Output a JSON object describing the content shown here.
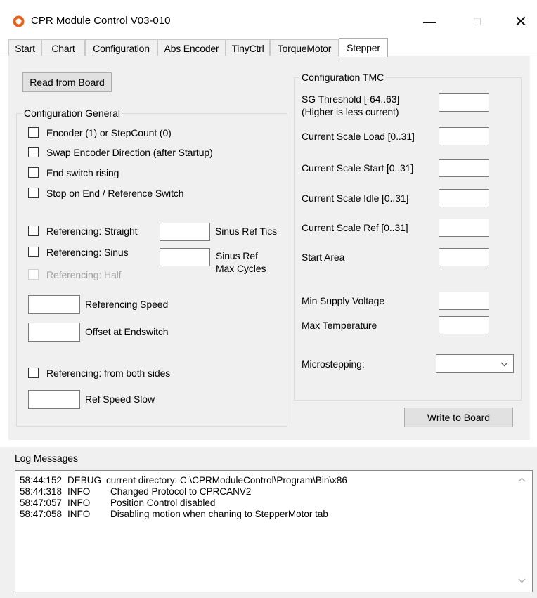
{
  "window": {
    "title": "CPR Module Control V03-010",
    "min_glyph": "—",
    "max_glyph": "☐",
    "close_glyph": "✕",
    "icon": "cpr-logo-icon",
    "icon_color": "#e8641e"
  },
  "tabs": [
    {
      "label": "Start"
    },
    {
      "label": "Chart"
    },
    {
      "label": "Configuration"
    },
    {
      "label": "Abs Encoder"
    },
    {
      "label": "TinyCtrl"
    },
    {
      "label": "TorqueMotor"
    },
    {
      "label": "Stepper",
      "active": true
    }
  ],
  "buttons": {
    "read": "Read from Board",
    "write": "Write to Board"
  },
  "config_general": {
    "title": "Configuration General",
    "checkboxes": [
      {
        "label": "Encoder (1) or StepCount (0)",
        "checked": false
      },
      {
        "label": "Swap Encoder Direction (after Startup)",
        "checked": false
      },
      {
        "label": "End switch rising",
        "checked": false
      },
      {
        "label": "Stop on End / Reference Switch",
        "checked": false
      },
      {
        "label": "Referencing: Straight",
        "checked": false
      },
      {
        "label": "Referencing: Sinus",
        "checked": false
      },
      {
        "label": "Referencing: Half",
        "checked": false,
        "disabled": true
      },
      {
        "label": "Referencing: from both sides",
        "checked": false
      }
    ],
    "sinus_ref_tics": {
      "label": "Sinus Ref Tics",
      "value": ""
    },
    "sinus_ref_max_cycles": {
      "label_line1": "Sinus Ref",
      "label_line2": "Max Cycles",
      "value": ""
    },
    "referencing_speed": {
      "label": "Referencing Speed",
      "value": ""
    },
    "offset_endswitch": {
      "label": "Offset at Endswitch",
      "value": ""
    },
    "ref_speed_slow": {
      "label": "Ref Speed Slow",
      "value": ""
    }
  },
  "config_tmc": {
    "title": "Configuration TMC",
    "sg_threshold": {
      "label_line1": "SG Threshold [-64..63]",
      "label_line2": "(Higher is less current)",
      "value": ""
    },
    "fields": [
      {
        "label": "Current Scale Load [0..31]",
        "value": ""
      },
      {
        "label": "Current Scale Start [0..31]",
        "value": ""
      },
      {
        "label": "Current Scale Idle [0..31]",
        "value": ""
      },
      {
        "label": "Current Scale Ref [0..31]",
        "value": ""
      },
      {
        "label": "Start Area",
        "value": ""
      },
      {
        "label": "Min Supply Voltage",
        "value": ""
      },
      {
        "label": "Max Temperature",
        "value": ""
      }
    ],
    "microstepping": {
      "label": "Microstepping:",
      "value": ""
    }
  },
  "log": {
    "title": "Log Messages",
    "entries": [
      {
        "time": "58:44:152",
        "level": "DEBUG",
        "message": "current directory: C:\\CPRModuleControl\\Program\\Bin\\x86"
      },
      {
        "time": "58:44:318",
        "level": "INFO",
        "message": "Changed Protocol to CPRCANV2"
      },
      {
        "time": "58:47:057",
        "level": "INFO",
        "message": "Position Control disabled"
      },
      {
        "time": "58:47:058",
        "level": "INFO",
        "message": "Disabling motion when chaning to StepperMotor tab"
      }
    ]
  }
}
